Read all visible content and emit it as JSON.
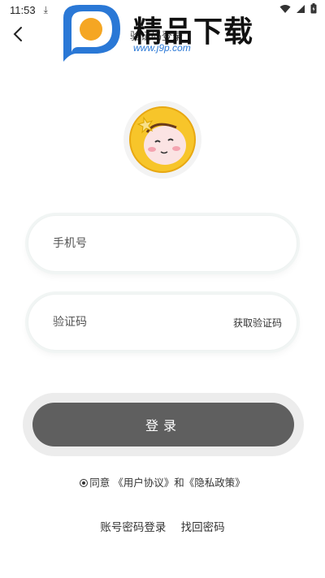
{
  "status_bar": {
    "time": "11:53",
    "download_glyph": "⤓"
  },
  "nav": {
    "title": "验证码登录"
  },
  "watermark": {
    "brand_text": "精品下载",
    "url": "www.j9p.com"
  },
  "form": {
    "phone_placeholder": "手机号",
    "code_placeholder": "验证码",
    "get_code_label": "获取验证码",
    "login_label": "登录"
  },
  "agreement": {
    "prefix": "同意",
    "user_agreement": "《用户协议》",
    "and": "和",
    "privacy_policy": "《隐私政策》"
  },
  "bottom_links": {
    "password_login": "账号密码登录",
    "recover_password": "找回密码"
  },
  "colors": {
    "login_button": "#5f5f5f",
    "watermark_blue": "#2a78d6",
    "watermark_orange": "#f5a623",
    "avatar_yellow": "#f7c52a"
  }
}
